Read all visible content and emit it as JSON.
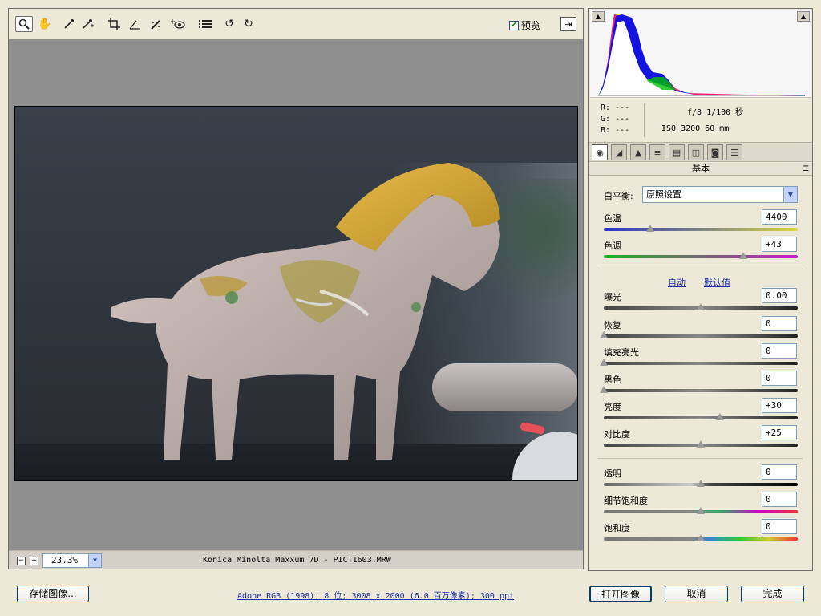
{
  "toolbar": {
    "tools": [
      {
        "name": "zoom-tool",
        "icon": "magnifier-icon"
      },
      {
        "name": "hand-tool",
        "icon": "hand-icon"
      },
      {
        "name": "white-balance-tool",
        "icon": "eyedropper-icon"
      },
      {
        "name": "color-sampler-tool",
        "icon": "color-sampler-icon"
      },
      {
        "name": "crop-tool",
        "icon": "crop-icon"
      },
      {
        "name": "straighten-tool",
        "icon": "straighten-icon"
      },
      {
        "name": "retouch-tool",
        "icon": "brush-icon"
      },
      {
        "name": "red-eye-tool",
        "icon": "red-eye-icon"
      },
      {
        "name": "presets-list",
        "icon": "list-icon"
      },
      {
        "name": "rotate-left",
        "icon": "rotate-ccw-icon"
      },
      {
        "name": "rotate-right",
        "icon": "rotate-cw-icon"
      }
    ],
    "preview_label": "预览",
    "preview_checked": true
  },
  "status": {
    "zoom": "23.3%",
    "file_info": "Konica Minolta Maxxum 7D -  PICT1603.MRW"
  },
  "readout": {
    "r": "R: ---",
    "g": "G: ---",
    "b": "B: ---",
    "line1": "f/8  1/100 秒",
    "line2": "ISO 3200  60 mm"
  },
  "panel": {
    "title": "基本",
    "white_balance_label": "白平衡:",
    "white_balance_value": "原照设置",
    "auto_label": "自动",
    "default_label": "默认值",
    "sliders": [
      {
        "key": "temperature",
        "label": "色温",
        "value": "4400",
        "position": 0.24
      },
      {
        "key": "tint",
        "label": "色调",
        "value": "+43",
        "position": 0.72
      },
      {
        "key": "exposure",
        "label": "曝光",
        "value": "0.00",
        "position": 0.5
      },
      {
        "key": "recovery",
        "label": "恢复",
        "value": "0",
        "position": 0.0
      },
      {
        "key": "fill-light",
        "label": "填充亮光",
        "value": "0",
        "position": 0.0
      },
      {
        "key": "blacks",
        "label": "黑色",
        "value": "0",
        "position": 0.0
      },
      {
        "key": "brightness",
        "label": "亮度",
        "value": "+30",
        "position": 0.6
      },
      {
        "key": "contrast",
        "label": "对比度",
        "value": "+25",
        "position": 0.5
      },
      {
        "key": "clarity",
        "label": "透明",
        "value": "0",
        "position": 0.5
      },
      {
        "key": "vibrance",
        "label": "细节饱和度",
        "value": "0",
        "position": 0.5
      },
      {
        "key": "saturation",
        "label": "饱和度",
        "value": "0",
        "position": 0.5
      }
    ]
  },
  "footer": {
    "save_label": "存储图像...",
    "color_info": "Adobe RGB (1998); 8 位; 3008 x 2000 (6.0 百万像素); 300 ppi",
    "open_label": "打开图像",
    "cancel_label": "取消",
    "done_label": "完成"
  },
  "colors": {
    "accent": "#1a2ea6",
    "preview_bg": "#8f8f8f",
    "panel_bg": "#ece9d8"
  }
}
